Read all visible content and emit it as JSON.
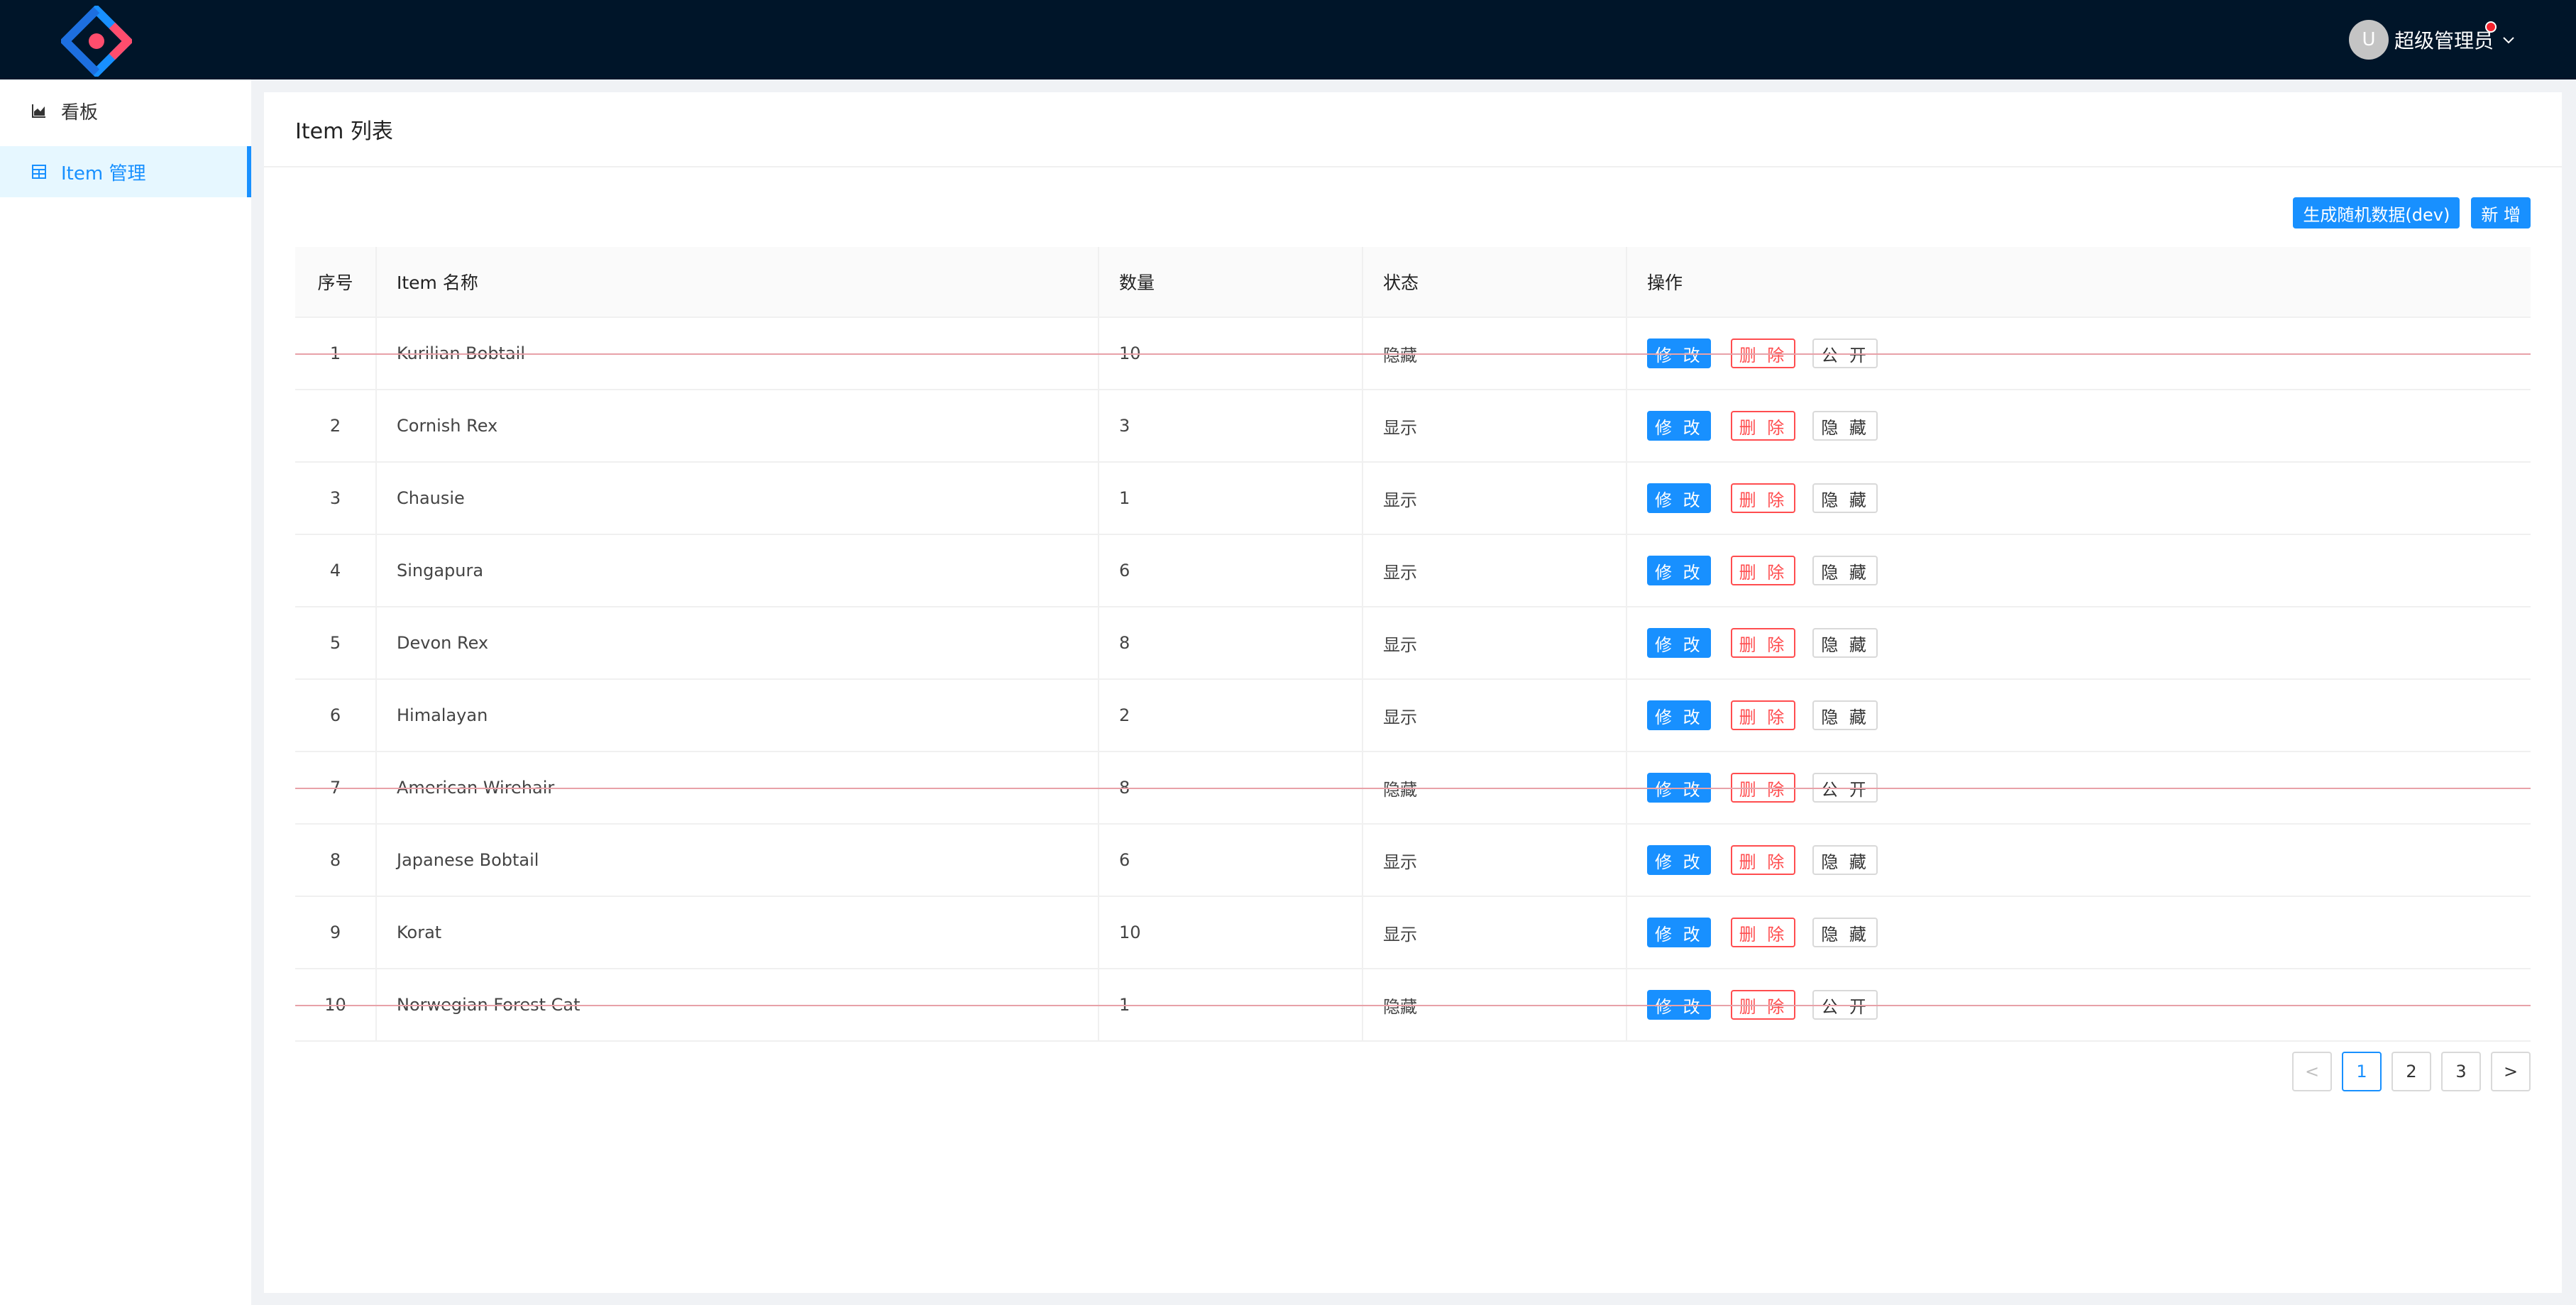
{
  "header": {
    "user_avatar_letter": "U",
    "user_name": "超级管理员"
  },
  "sidebar": {
    "items": [
      {
        "label": "看板",
        "icon": "area-chart-icon",
        "active": false
      },
      {
        "label": "Item 管理",
        "icon": "table-icon",
        "active": true
      }
    ]
  },
  "main": {
    "title": "Item 列表",
    "toolbar": {
      "generate_label": "生成随机数据(dev)",
      "add_label": "新 增"
    },
    "table": {
      "columns": [
        "序号",
        "Item 名称",
        "数量",
        "状态",
        "操作"
      ],
      "rows": [
        {
          "idx": "1",
          "name": "Kurilian Bobtail",
          "qty": "10",
          "status": "隐藏",
          "toggle": "公 开",
          "struck": true
        },
        {
          "idx": "2",
          "name": "Cornish Rex",
          "qty": "3",
          "status": "显示",
          "toggle": "隐 藏",
          "struck": false
        },
        {
          "idx": "3",
          "name": "Chausie",
          "qty": "1",
          "status": "显示",
          "toggle": "隐 藏",
          "struck": false
        },
        {
          "idx": "4",
          "name": "Singapura",
          "qty": "6",
          "status": "显示",
          "toggle": "隐 藏",
          "struck": false
        },
        {
          "idx": "5",
          "name": "Devon Rex",
          "qty": "8",
          "status": "显示",
          "toggle": "隐 藏",
          "struck": false
        },
        {
          "idx": "6",
          "name": "Himalayan",
          "qty": "2",
          "status": "显示",
          "toggle": "隐 藏",
          "struck": false
        },
        {
          "idx": "7",
          "name": "American Wirehair",
          "qty": "8",
          "status": "隐藏",
          "toggle": "公 开",
          "struck": true
        },
        {
          "idx": "8",
          "name": "Japanese Bobtail",
          "qty": "6",
          "status": "显示",
          "toggle": "隐 藏",
          "struck": false
        },
        {
          "idx": "9",
          "name": "Korat",
          "qty": "10",
          "status": "显示",
          "toggle": "隐 藏",
          "struck": false
        },
        {
          "idx": "10",
          "name": "Norwegian Forest Cat",
          "qty": "1",
          "status": "隐藏",
          "toggle": "公 开",
          "struck": true
        }
      ],
      "edit_label": "修 改",
      "delete_label": "删 除"
    },
    "pagination": {
      "prev": "<",
      "pages": [
        "1",
        "2",
        "3"
      ],
      "current": "1",
      "next": ">"
    }
  },
  "colors": {
    "header_bg": "#001529",
    "accent": "#1890ff",
    "danger": "#ff4d4f",
    "strike": "#e8a1a8"
  }
}
